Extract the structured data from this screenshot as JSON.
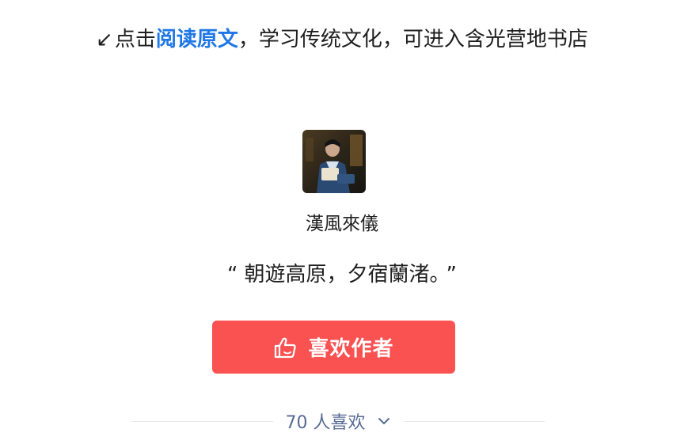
{
  "read_prompt": {
    "arrow": "↙",
    "pre": "点击",
    "link": "阅读原文",
    "post": "，学习传统文化，可进入含光营地书店"
  },
  "author": {
    "name": "漢風來儀",
    "avatar_icon": "author-avatar"
  },
  "quote": {
    "open": "“",
    "text": "朝遊高原，夕宿蘭渚。",
    "close": "”"
  },
  "like_button": {
    "label": "喜欢作者",
    "icon": "thumbs-up-icon",
    "color": "#fa5151"
  },
  "likers": {
    "count_text": "70 人喜欢",
    "icon": "chevron-down-icon",
    "color": "#576b95"
  }
}
